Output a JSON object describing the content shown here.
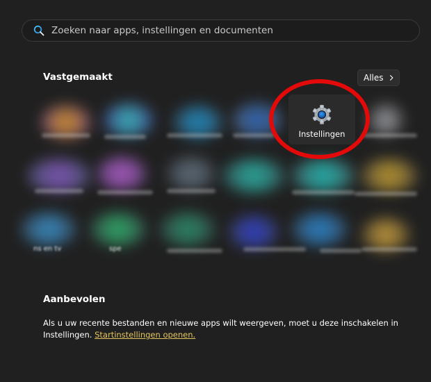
{
  "search": {
    "placeholder": "Zoeken naar apps, instellingen en documenten",
    "value": ""
  },
  "pinned": {
    "title": "Vastgemaakt",
    "all_label": "Alles",
    "settings_app": {
      "label": "Instellingen",
      "icon": "gear-icon"
    },
    "obscured_labels": [
      "ns en tv",
      "spe"
    ]
  },
  "recommended": {
    "title": "Aanbevolen",
    "text_part1": "Als u uw recente bestanden en nieuwe apps wilt weergeven, moet u deze inschakelen in Instellingen.",
    "link_label": "Startinstellingen openen."
  },
  "colors": {
    "background": "#202020",
    "accent_link": "#e6c55e",
    "highlight": "#e50a0a"
  }
}
